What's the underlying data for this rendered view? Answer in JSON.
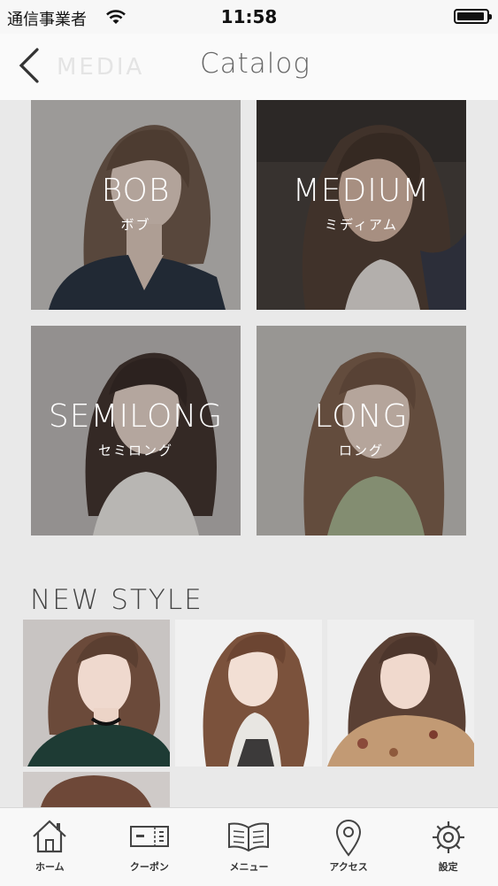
{
  "status_bar": {
    "carrier": "通信事業者",
    "time": "11:58"
  },
  "nav": {
    "title": "Catalog"
  },
  "categories": [
    {
      "name": "BOB",
      "kana": "ボブ"
    },
    {
      "name": "MEDIUM",
      "kana": "ミディアム"
    },
    {
      "name": "SEMILONG",
      "kana": "セミロング"
    },
    {
      "name": "LONG",
      "kana": "ロング"
    }
  ],
  "new_style": {
    "title": "NEW STYLE"
  },
  "tabs": [
    {
      "label": "ホーム",
      "icon": "home-icon"
    },
    {
      "label": "クーポン",
      "icon": "coupon-icon"
    },
    {
      "label": "メニュー",
      "icon": "menu-book-icon"
    },
    {
      "label": "アクセス",
      "icon": "location-pin-icon"
    },
    {
      "label": "設定",
      "icon": "gear-icon"
    }
  ]
}
